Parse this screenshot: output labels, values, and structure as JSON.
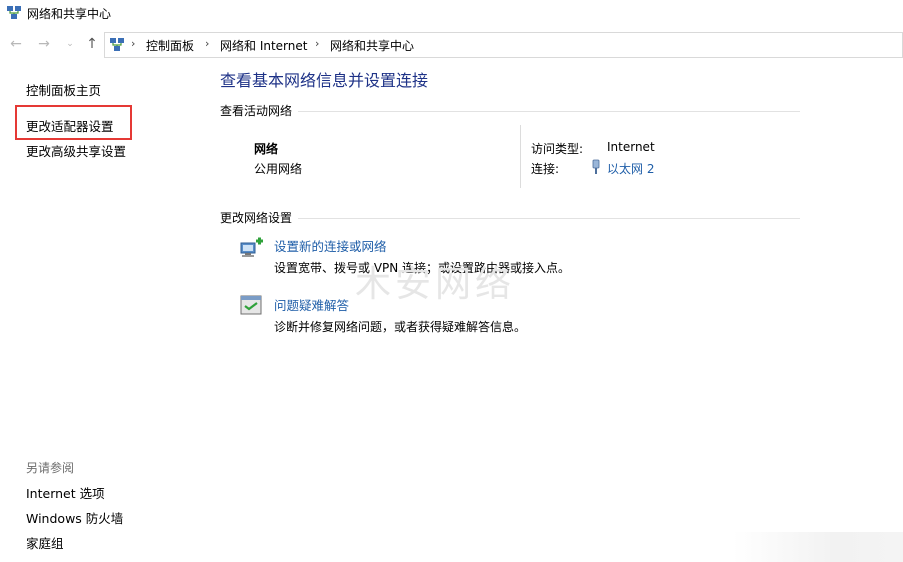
{
  "window": {
    "title": "网络和共享中心"
  },
  "address": {
    "crumbs": [
      "控制面板",
      "网络和 Internet",
      "网络和共享中心"
    ]
  },
  "sidebar": {
    "home": "控制面板主页",
    "items": [
      "更改适配器设置",
      "更改高级共享设置"
    ],
    "see_also_title": "另请参阅",
    "see_also": [
      "Internet 选项",
      "Windows 防火墙",
      "家庭组"
    ]
  },
  "main": {
    "title": "查看基本网络信息并设置连接",
    "active_header": "查看活动网络",
    "network": {
      "name": "网络",
      "type": "公用网络",
      "access_label": "访问类型:",
      "access_value": "Internet",
      "conn_label": "连接:",
      "conn_value": "以太网 2"
    },
    "change_header": "更改网络设置",
    "tasks": [
      {
        "link": "设置新的连接或网络",
        "desc": "设置宽带、拨号或 VPN 连接；或设置路由器或接入点。",
        "icon": "new-connection-icon"
      },
      {
        "link": "问题疑难解答",
        "desc": "诊断并修复网络问题，或者获得疑难解答信息。",
        "icon": "troubleshoot-icon"
      }
    ]
  },
  "watermark": "木安网络",
  "colors": {
    "title_blue": "#1e3287",
    "link_blue": "#1f5ea8",
    "highlight_red": "#e53935"
  }
}
